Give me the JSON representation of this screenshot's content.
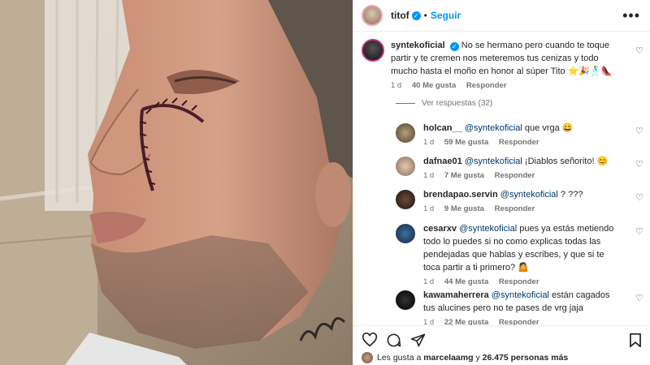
{
  "header": {
    "username": "titof",
    "follow_label": "Seguir",
    "more_label": "•••"
  },
  "caption": {
    "username": "syntekoficial",
    "text": "No se hermano pero cuando te toque partir y te cremen nos meteremos tus cenizas y todo mucho hasta el moño en honor al súper Tito ⭐🎉🕺👠",
    "time": "1 d",
    "likes": "40 Me gusta",
    "reply": "Responder",
    "view_replies": "Ver respuestas (32)"
  },
  "comments": [
    {
      "user": "holcan__",
      "mention": "@syntekoficial",
      "text": "que vrga 😀",
      "time": "1 d",
      "likes": "59 Me gusta",
      "reply": "Responder"
    },
    {
      "user": "dafnae01",
      "mention": "@syntekoficial",
      "text": "¡Diablos señorito! 😊",
      "time": "1 d",
      "likes": "7 Me gusta",
      "reply": "Responder"
    },
    {
      "user": "brendapao.servin",
      "mention": "@syntekoficial",
      "text": "? ???",
      "time": "1 d",
      "likes": "9 Me gusta",
      "reply": "Responder"
    },
    {
      "user": "cesarxv",
      "mention": "@syntekoficial",
      "text": "pues ya estás metiendo todo lo puedes si no como explicas todas las pendejadas que hablas y escribes, y que si te toca partir a ti primero? 🤷",
      "time": "1 d",
      "likes": "44 Me gusta",
      "reply": "Responder"
    },
    {
      "user": "kawamaherrera",
      "mention": "@syntekoficial",
      "text": "están cagados tus alucines pero no te pases de vrg jaja",
      "time": "1 d",
      "likes": "22 Me gusta",
      "reply": "Responder"
    }
  ],
  "footer": {
    "likes_prefix": "Les gusta a",
    "likes_user": "marcelaamg",
    "likes_and": "y",
    "likes_count": "26.475 personas más"
  },
  "colors": {
    "accent": "#0095f6",
    "mention": "#00376b",
    "muted": "#737373"
  },
  "icons": [
    "heart-icon",
    "comment-icon",
    "share-icon",
    "bookmark-icon",
    "more-icon",
    "verified-icon"
  ]
}
